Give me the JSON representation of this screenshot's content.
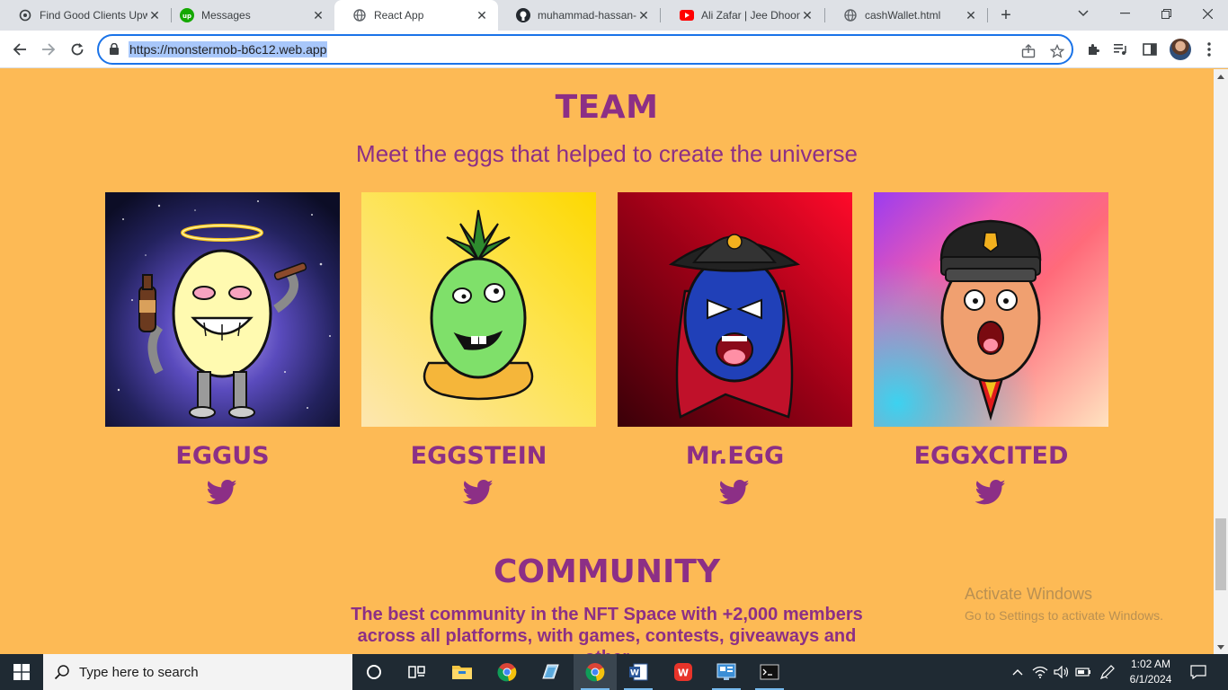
{
  "browser": {
    "tabs": [
      {
        "label": "Find Good Clients Upw",
        "icon": "openai-icon",
        "active": false
      },
      {
        "label": "Messages",
        "icon": "upwork-icon",
        "active": false
      },
      {
        "label": "React App",
        "icon": "globe-icon",
        "active": true
      },
      {
        "label": "muhammad-hassan-n",
        "icon": "github-icon",
        "active": false
      },
      {
        "label": "Ali Zafar | Jee Dhoond",
        "icon": "youtube-icon",
        "active": false
      },
      {
        "label": "cashWallet.html",
        "icon": "globe-icon",
        "active": false
      }
    ],
    "url": "https://monstermob-b6c12.web.app"
  },
  "page": {
    "team": {
      "title": "TEAM",
      "subtitle": "Meet the eggs that helped to create the universe",
      "members": [
        {
          "name": "EGGUS",
          "background": "space-galaxy",
          "twitter_icon": "twitter-icon"
        },
        {
          "name": "EGGSTEIN",
          "background": "yellow-gradient",
          "twitter_icon": "twitter-icon"
        },
        {
          "name": "Mr.EGG",
          "background": "red-gradient",
          "twitter_icon": "twitter-icon"
        },
        {
          "name": "EGGXCITED",
          "background": "rainbow-gradient",
          "twitter_icon": "twitter-icon"
        }
      ]
    },
    "community": {
      "title": "COMMUNITY",
      "line1": "The best community in the NFT Space with +2,000 members",
      "line2": "across all platforms, with games, contests, giveaways and other"
    }
  },
  "watermark": {
    "line1": "Activate Windows",
    "line2": "Go to Settings to activate Windows."
  },
  "taskbar": {
    "search_placeholder": "Type here to search",
    "time": "1:02 AM",
    "date": "6/1/2024"
  },
  "colors": {
    "page_bg": "#fdba55",
    "accent": "#8c2f86",
    "url_highlight": "#a8c7fa"
  }
}
